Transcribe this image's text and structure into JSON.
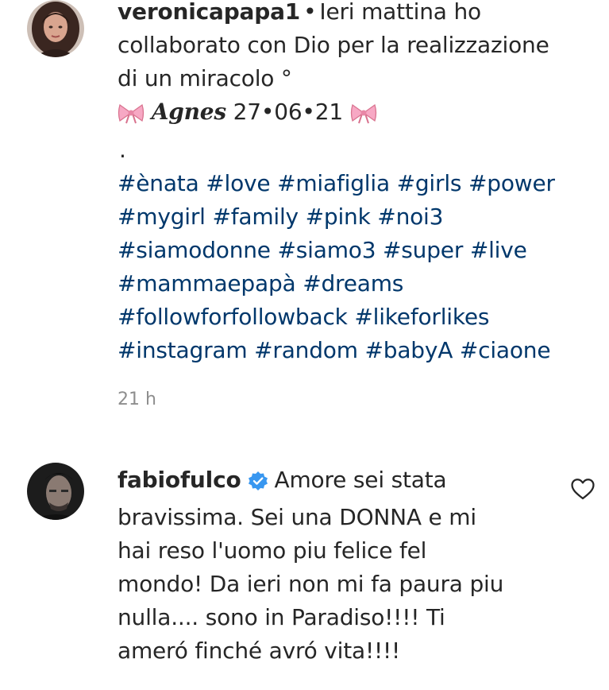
{
  "comments": [
    {
      "username": "veronicapapa1",
      "separator": "•",
      "text_lines": [
        "Ieri mattina ho",
        "collaborato con Dio per la realizzazione",
        "di un miracolo °"
      ],
      "signature_name": "Agnes",
      "signature_date": "27•06•21",
      "dot_line": ".",
      "hashtag_lines": [
        "#ènata #love #miafiglia #girls #power",
        "#mygirl #family #pink #noi3",
        "#siamodonne #siamo3 #super #live",
        "#mammaepapà #dreams",
        "#followforfollowback #likeforlikes",
        "#instagram #random #babyA #ciaone"
      ],
      "timestamp": "21 h"
    },
    {
      "username": "fabiofulco",
      "verified": true,
      "text_first": "Amore sei stata",
      "text_lines": [
        "bravissima. Sei una DONNA e mi",
        "hai reso l'uomo piu felice fel",
        "mondo! Da ieri non mi fa paura piu",
        "nulla.... sono in Paradiso!!!! Ti",
        "ameró finché avró vita!!!!"
      ]
    }
  ],
  "icons": {
    "like": "heart-outline-icon",
    "verified": "verified-badge-icon",
    "bow": "ribbon-bow-emoji"
  },
  "colors": {
    "text": "#262626",
    "hashtag": "#00376b",
    "meta": "#8e8e8e",
    "verified": "#3897f0",
    "bow": "#f7a8c4"
  }
}
